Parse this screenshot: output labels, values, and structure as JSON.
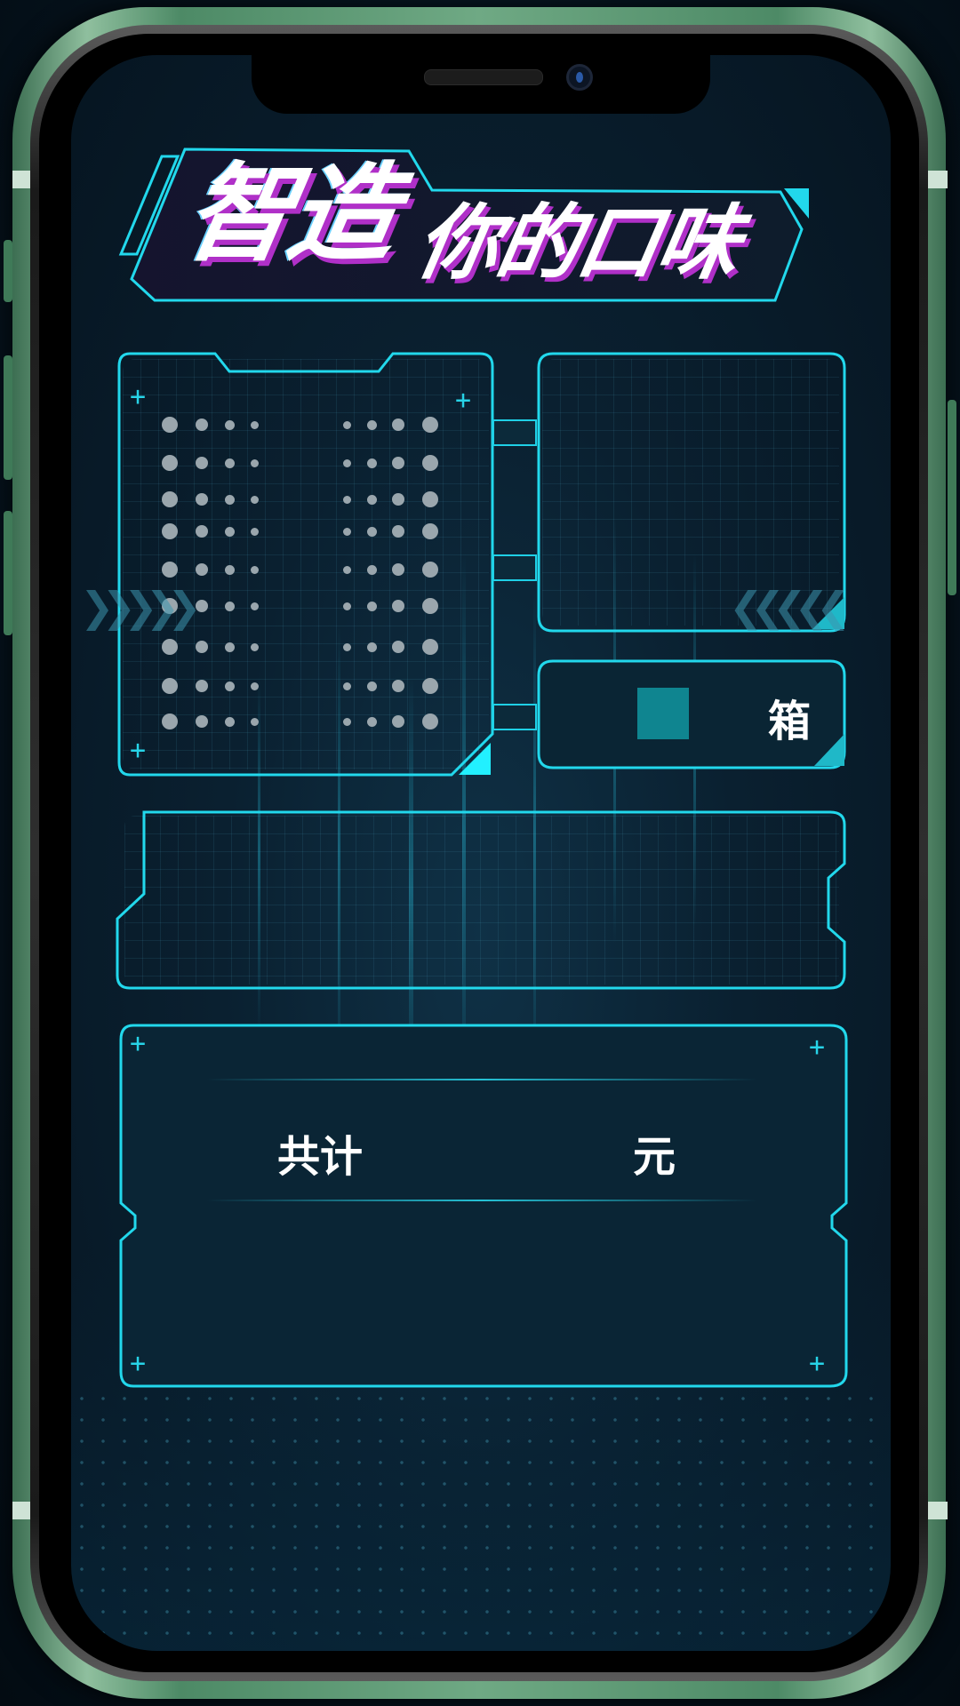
{
  "title": {
    "big": "智造",
    "small": "你的口味"
  },
  "box_panel": {
    "unit": "箱",
    "swatch_color": "#0f8590"
  },
  "total_panel": {
    "prefix": "共计",
    "suffix": "元"
  },
  "colors": {
    "accent": "#22d8ec",
    "title_shadow": "#b030c8",
    "frame": "#5e9d77"
  }
}
